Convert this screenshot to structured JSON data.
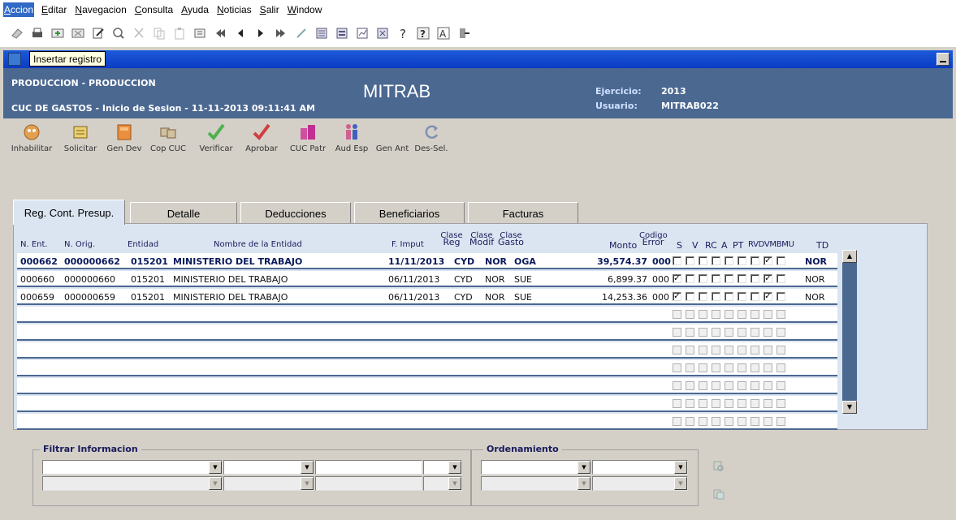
{
  "menu": [
    {
      "label": "Accion",
      "active": true
    },
    {
      "label": "Editar"
    },
    {
      "label": "Navegacion"
    },
    {
      "label": "Consulta"
    },
    {
      "label": "Ayuda"
    },
    {
      "label": "Noticias"
    },
    {
      "label": "Salir"
    },
    {
      "label": "Window"
    }
  ],
  "tooltip": "Insertar registro",
  "header": {
    "left_title": "PRODUCCION - PRODUCCION",
    "subtitle": "CUC DE GASTOS - Inicio de Sesion - 11-11-2013 09:11:41 AM",
    "center": "MITRAB",
    "ejercicio_label": "Ejercicio:",
    "ejercicio_value": "2013",
    "usuario_label": "Usuario:",
    "usuario_value": "MITRAB022"
  },
  "actions": [
    {
      "label": "Inhabilitar",
      "icon": "disable-icon"
    },
    {
      "label": "Solicitar",
      "icon": "request-icon"
    },
    {
      "label": "Gen Dev",
      "icon": "generate-icon"
    },
    {
      "label": "Cop CUC",
      "icon": "copy-icon"
    },
    {
      "label": "Verificar",
      "icon": "check-icon"
    },
    {
      "label": "Aprobar",
      "icon": "approve-icon"
    },
    {
      "label": "CUC Patr",
      "icon": "patrimony-icon"
    },
    {
      "label": "Aud Esp",
      "icon": "audit-icon"
    },
    {
      "label": "Gen Ant",
      "icon": "advance-icon"
    },
    {
      "label": "Des-Sel.",
      "icon": "refresh-icon"
    }
  ],
  "tabs": [
    {
      "label": "Reg. Cont. Presup.",
      "active": true
    },
    {
      "label": "Detalle"
    },
    {
      "label": "Deducciones"
    },
    {
      "label": "Beneficiarios"
    },
    {
      "label": "Facturas"
    }
  ],
  "columns": {
    "n_ent": "N. Ent.",
    "n_orig": "N. Orig.",
    "entidad": "Entidad",
    "nombre": "Nombre de la Entidad",
    "f_imput": "F. Imput",
    "clase_reg_top": "Clase",
    "clase_reg_bot": "Reg",
    "clase_modif_top": "Clase",
    "clase_modif_bot": "Modif",
    "clase_gasto_top": "Clase",
    "clase_gasto_bot": "Gasto",
    "monto": "Monto",
    "codigo_top": "Codigo",
    "codigo_bot": "Error",
    "s": "S",
    "v": "V",
    "rc": "RC",
    "a": "A",
    "pt": "PT",
    "rvdvmbmu": "RVDVMBMU",
    "td": "TD"
  },
  "rows": [
    {
      "n_ent": "000662",
      "n_orig": "000000662",
      "entidad": "015201",
      "nombre": "MINISTERIO DEL TRABAJO",
      "f_imput": "11/11/2013",
      "reg": "CYD",
      "modif": "NOR",
      "gasto": "OGA",
      "monto": "39,574.37",
      "error": "000",
      "checks": [
        false,
        false,
        false,
        false,
        false,
        false,
        false,
        true,
        false
      ],
      "td": "NOR"
    },
    {
      "n_ent": "000660",
      "n_orig": "000000660",
      "entidad": "015201",
      "nombre": "MINISTERIO DEL TRABAJO",
      "f_imput": "06/11/2013",
      "reg": "CYD",
      "modif": "NOR",
      "gasto": "SUE",
      "monto": "6,899.37",
      "error": "000",
      "checks": [
        true,
        false,
        false,
        false,
        false,
        false,
        false,
        true,
        false
      ],
      "td": "NOR"
    },
    {
      "n_ent": "000659",
      "n_orig": "000000659",
      "entidad": "015201",
      "nombre": "MINISTERIO DEL TRABAJO",
      "f_imput": "06/11/2013",
      "reg": "CYD",
      "modif": "NOR",
      "gasto": "SUE",
      "monto": "14,253.36",
      "error": "000",
      "checks": [
        true,
        false,
        false,
        false,
        false,
        false,
        false,
        true,
        false
      ],
      "td": "NOR"
    }
  ],
  "filter": {
    "legend": "Filtrar Informacion"
  },
  "order": {
    "legend": "Ordenamiento"
  },
  "colors": {
    "header_bg": "#4b6891",
    "titlebar": "#0a3cc4",
    "grid_bg": "#dbe5f1"
  }
}
